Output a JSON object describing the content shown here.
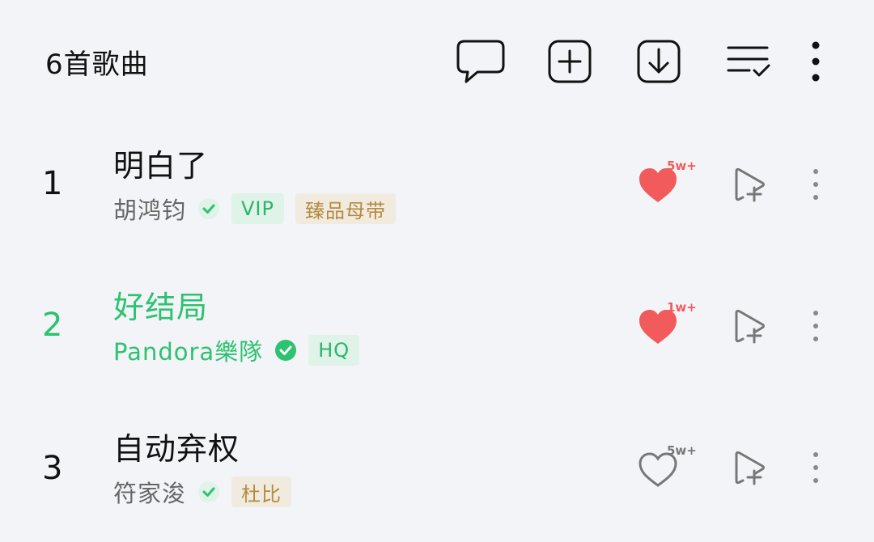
{
  "header": {
    "song_count": "6首歌曲",
    "icons": [
      "comment-icon",
      "add-icon",
      "download-icon",
      "multi-select-icon",
      "more-icon"
    ]
  },
  "colors": {
    "accent": "#2dc26f",
    "like_red": "#f25b5b",
    "vip_tag": "#2cb56a",
    "quality_tag": "#b58a40"
  },
  "songs": [
    {
      "index": "1",
      "title": "明白了",
      "artist": "胡鸿钧",
      "tags": [
        "VIP",
        "臻品母带"
      ],
      "likes": "5w+",
      "liked": true,
      "playing": false
    },
    {
      "index": "2",
      "title": "好结局",
      "artist": "Pandora樂隊",
      "tags": [
        "HQ"
      ],
      "likes": "1w+",
      "liked": true,
      "playing": true
    },
    {
      "index": "3",
      "title": "自动弃权",
      "artist": "符家浚",
      "tags": [
        "杜比"
      ],
      "likes": "5w+",
      "liked": false,
      "playing": false
    }
  ]
}
